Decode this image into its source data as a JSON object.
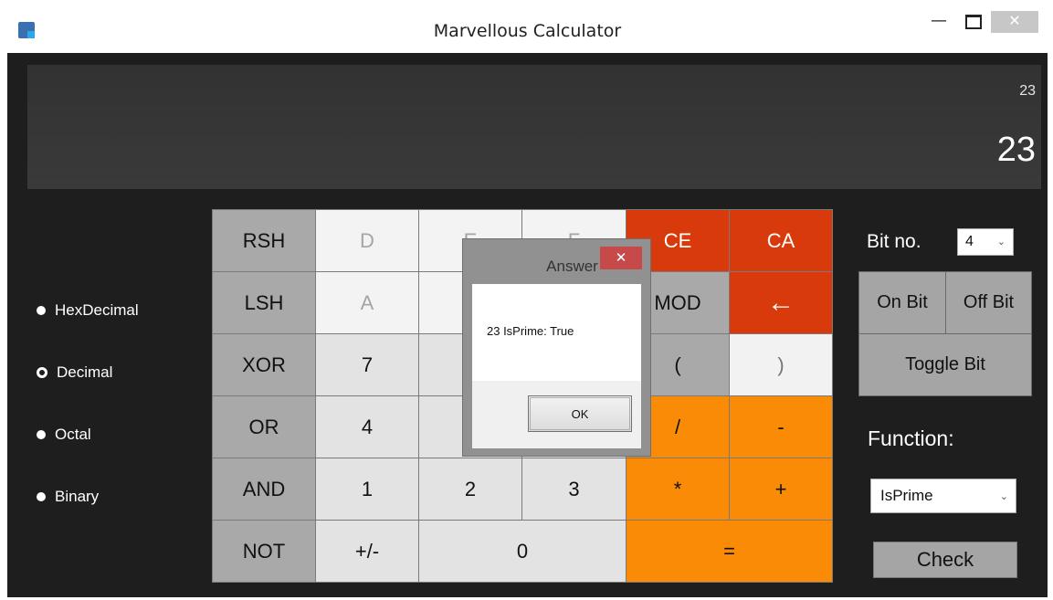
{
  "window": {
    "title": "Marvellous Calculator",
    "minimize": "—",
    "close": "✕"
  },
  "display": {
    "history": "23",
    "value": "23"
  },
  "number_systems": [
    {
      "label": "HexDecimal",
      "selected": false
    },
    {
      "label": "Decimal",
      "selected": true
    },
    {
      "label": "Octal",
      "selected": false
    },
    {
      "label": "Binary",
      "selected": false
    }
  ],
  "keys": {
    "rsh": "RSH",
    "lsh": "LSH",
    "xor": "XOR",
    "or": "OR",
    "and": "AND",
    "not": "NOT",
    "d": "D",
    "e": "E",
    "f": "F",
    "a": "A",
    "ce": "CE",
    "ca": "CA",
    "mod": "MOD",
    "backspace": "←",
    "open_paren": "(",
    "close_paren": ")",
    "seven": "7",
    "four": "4",
    "one": "1",
    "two": "2",
    "three": "3",
    "divide": "/",
    "minus": "-",
    "multiply": "*",
    "plus": "+",
    "negate": "+/-",
    "zero": "0",
    "equals": "="
  },
  "bits": {
    "label": "Bit no.",
    "selected": "4",
    "on_label": "On Bit",
    "off_label": "Off Bit",
    "toggle_label": "Toggle Bit"
  },
  "function": {
    "label": "Function:",
    "selected": "IsPrime",
    "check_label": "Check"
  },
  "dialog": {
    "title": "Answer",
    "close": "✕",
    "message": "23 IsPrime: True",
    "ok_label": "OK"
  },
  "colors": {
    "background": "#1e1e1e",
    "operator_red": "#d83a0c",
    "operator_orange": "#fa8b07",
    "key_gray": "#a9a9a9"
  }
}
